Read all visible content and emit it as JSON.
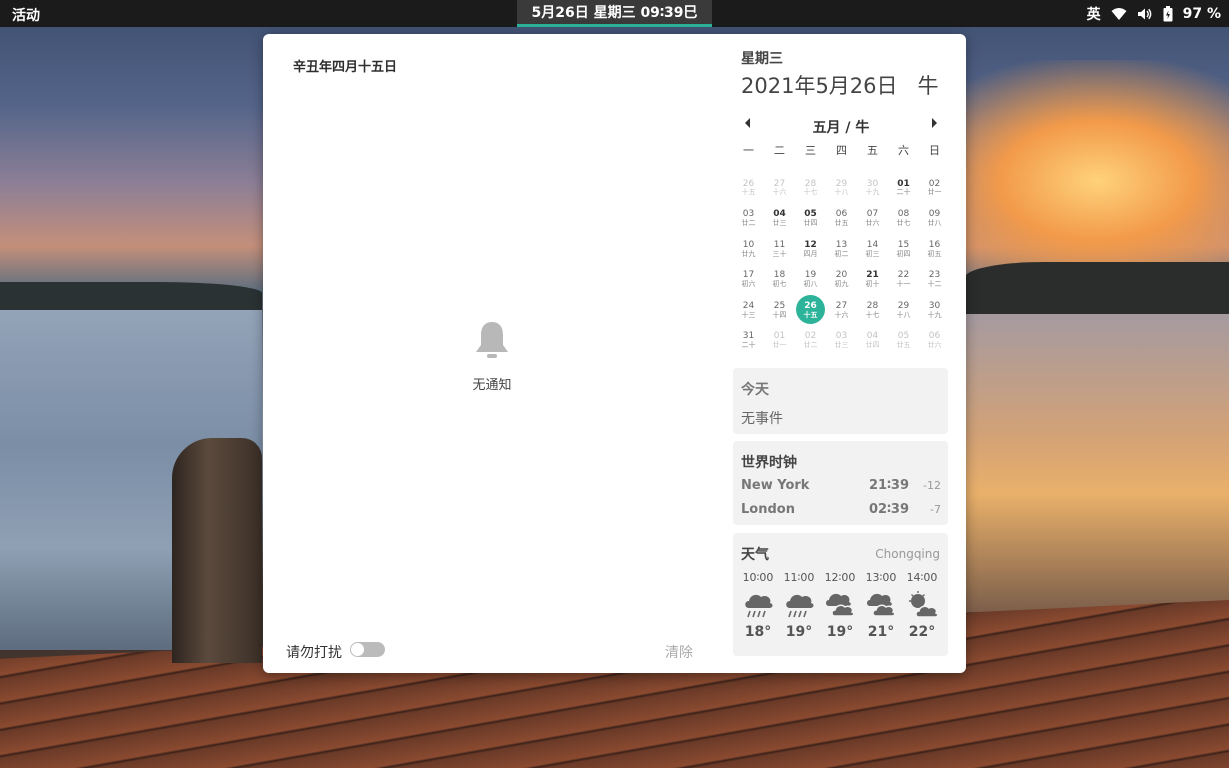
{
  "topbar": {
    "activities": "活动",
    "clock": "5月26日 星期三  09∶39巳",
    "input_method": "英",
    "battery": "97 %",
    "icons": [
      "wifi-icon",
      "volume-icon",
      "battery-icon"
    ]
  },
  "notifications": {
    "lunar_date": "辛丑年四月十五日",
    "empty_text": "无通知",
    "dnd_label": "请勿打扰",
    "dnd_enabled": false,
    "clear_label": "清除"
  },
  "calendar": {
    "weekday": "星期三",
    "full_date": "2021年5月26日",
    "zodiac": "牛",
    "month_label": "五月 / 牛",
    "weekdays": [
      "一",
      "二",
      "三",
      "四",
      "五",
      "六",
      "日"
    ],
    "days": [
      {
        "d": "26",
        "l": "十五",
        "other": true
      },
      {
        "d": "27",
        "l": "十六",
        "other": true
      },
      {
        "d": "28",
        "l": "十七",
        "other": true
      },
      {
        "d": "29",
        "l": "十八",
        "other": true
      },
      {
        "d": "30",
        "l": "十九",
        "other": true
      },
      {
        "d": "01",
        "l": "二十",
        "bold": true
      },
      {
        "d": "02",
        "l": "廿一"
      },
      {
        "d": "03",
        "l": "廿二"
      },
      {
        "d": "04",
        "l": "廿三",
        "bold": true
      },
      {
        "d": "05",
        "l": "廿四",
        "bold": true
      },
      {
        "d": "06",
        "l": "廿五"
      },
      {
        "d": "07",
        "l": "廿六"
      },
      {
        "d": "08",
        "l": "廿七"
      },
      {
        "d": "09",
        "l": "廿八"
      },
      {
        "d": "10",
        "l": "廿九"
      },
      {
        "d": "11",
        "l": "三十"
      },
      {
        "d": "12",
        "l": "四月",
        "bold": true
      },
      {
        "d": "13",
        "l": "初二"
      },
      {
        "d": "14",
        "l": "初三"
      },
      {
        "d": "15",
        "l": "初四"
      },
      {
        "d": "16",
        "l": "初五"
      },
      {
        "d": "17",
        "l": "初六"
      },
      {
        "d": "18",
        "l": "初七"
      },
      {
        "d": "19",
        "l": "初八"
      },
      {
        "d": "20",
        "l": "初九"
      },
      {
        "d": "21",
        "l": "初十",
        "bold": true
      },
      {
        "d": "22",
        "l": "十一"
      },
      {
        "d": "23",
        "l": "十二"
      },
      {
        "d": "24",
        "l": "十三"
      },
      {
        "d": "25",
        "l": "十四"
      },
      {
        "d": "26",
        "l": "十五",
        "today": true
      },
      {
        "d": "27",
        "l": "十六"
      },
      {
        "d": "28",
        "l": "十七"
      },
      {
        "d": "29",
        "l": "十八"
      },
      {
        "d": "30",
        "l": "十九"
      },
      {
        "d": "31",
        "l": "二十"
      },
      {
        "d": "01",
        "l": "廿一",
        "other": true
      },
      {
        "d": "02",
        "l": "廿二",
        "other": true
      },
      {
        "d": "03",
        "l": "廿三",
        "other": true
      },
      {
        "d": "04",
        "l": "廿四",
        "other": true
      },
      {
        "d": "05",
        "l": "廿五",
        "other": true
      },
      {
        "d": "06",
        "l": "廿六",
        "other": true
      }
    ]
  },
  "events": {
    "title": "今天",
    "empty_text": "无事件"
  },
  "world_clocks": {
    "title": "世界时钟",
    "rows": [
      {
        "city": "New York",
        "time": "21∶39",
        "offset": "-12"
      },
      {
        "city": "London",
        "time": "02∶39",
        "offset": "-7"
      }
    ]
  },
  "weather": {
    "title": "天气",
    "location": "Chongqing",
    "forecast": [
      {
        "hour": "10∶00",
        "temp": "18°",
        "icon": "rain-icon"
      },
      {
        "hour": "11∶00",
        "temp": "19°",
        "icon": "rain-icon"
      },
      {
        "hour": "12∶00",
        "temp": "19°",
        "icon": "overcast-icon"
      },
      {
        "hour": "13∶00",
        "temp": "21°",
        "icon": "overcast-icon"
      },
      {
        "hour": "14∶00",
        "temp": "22°",
        "icon": "partly-cloudy-icon"
      }
    ]
  },
  "colors": {
    "accent": "#2cb39a",
    "topbar": "#1b1b1b",
    "panel": "#ffffff",
    "card": "#f2f2f2"
  }
}
